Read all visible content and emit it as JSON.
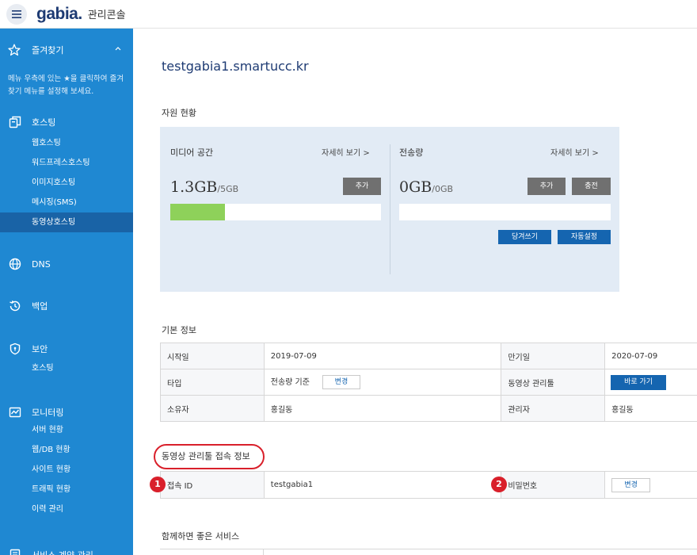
{
  "app": {
    "logo": "gabia.",
    "title": "관리콘솔"
  },
  "sidebar": {
    "favorites_label": "즐겨찾기",
    "favorites_desc": "메뉴 우측에 있는 ★을 클릭하여 즐겨찾기 메뉴를 설정해 보세요.",
    "sections": [
      {
        "label": "호스팅",
        "icon": "hosting-icon",
        "items": [
          "웹호스팅",
          "워드프레스호스팅",
          "이미지호스팅",
          "메시징(SMS)",
          "동영상호스팅"
        ],
        "active_index": 4
      },
      {
        "label": "DNS",
        "icon": "globe-icon",
        "items": []
      },
      {
        "label": "백업",
        "icon": "backup-icon",
        "items": []
      },
      {
        "label": "보안",
        "icon": "shield-icon",
        "items": [
          "호스팅"
        ]
      },
      {
        "label": "모니터링",
        "icon": "monitor-icon",
        "items": [
          "서버 현황",
          "웹/DB 현황",
          "사이트 현황",
          "트래픽 현황",
          "이력 관리"
        ]
      },
      {
        "label": "서비스 계약 관리",
        "icon": "contract-icon",
        "items": []
      }
    ]
  },
  "main": {
    "domain": "testgabia1.smartucc.kr",
    "resources": {
      "heading": "자원 현황",
      "media": {
        "title": "미디어 공간",
        "detail_link": "자세히 보기 >",
        "used": "1.3GB",
        "total": "/5GB",
        "fill_fraction": 0.26,
        "add_button": "추가"
      },
      "transfer": {
        "title": "전송량",
        "detail_link": "자세히 보기 >",
        "used": "0GB",
        "total": "/0GB",
        "fill_fraction": 0,
        "add_button": "추가",
        "charge_button": "충전",
        "advance_button": "당겨쓰기",
        "auto_button": "자동설정"
      }
    },
    "basic": {
      "heading": "기본 정보",
      "start_label": "시작일",
      "start_value": "2019-07-09",
      "end_label": "만기일",
      "end_value": "2020-07-09",
      "type_label": "타입",
      "type_value": "전송량 기준",
      "type_change": "변경",
      "manager_tool_label": "동영상 관리툴",
      "manager_tool_button": "바로 가기",
      "owner_label": "소유자",
      "owner_value": "홍길동",
      "admin_label": "관리자",
      "admin_value": "홍길동"
    },
    "access": {
      "heading": "동영상 관리툴 접속 정보",
      "id_label": "접속 ID",
      "id_value": "testgabia1",
      "pw_label": "비밀번호",
      "pw_change": "변경",
      "badge1": "1",
      "badge2": "2"
    },
    "services_heading": "함께하면 좋은 서비스"
  },
  "colors": {
    "sidebar": "#1f88d2",
    "sidebar_active": "#1963a6",
    "accent_blue": "#1565b0",
    "progress_fill": "#8ed15a",
    "highlight_red": "#d9202b"
  }
}
